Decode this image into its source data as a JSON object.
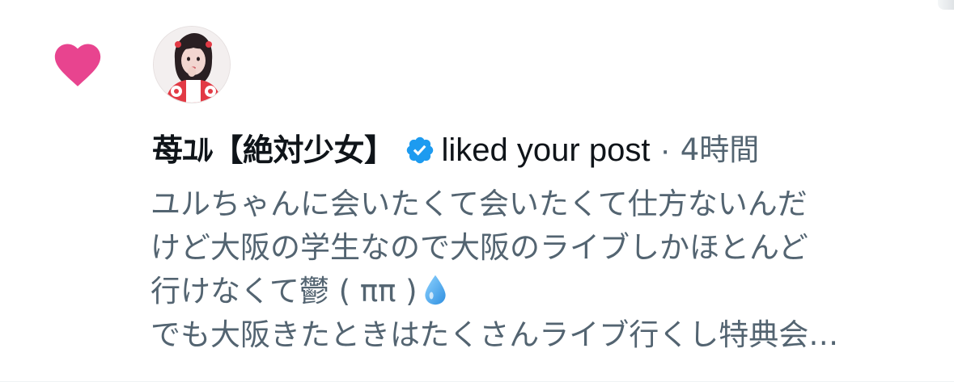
{
  "notification": {
    "type_icon": "heart-icon",
    "user": {
      "display_name": "苺ﾕﾙ【絶対少女】",
      "verified": true,
      "badge_icon": "verified-badge-icon"
    },
    "action": "liked your post",
    "separator": "·",
    "time": "4時間",
    "post_lines": [
      "ユルちゃんに会いたくて会いたくて仕方ないんだ",
      "けど大阪の学生なので大阪のライブしかほとんど",
      "行けなくて鬱 ( ππ )",
      "でも大阪きたときはたくさんライブ行くし特典会…"
    ],
    "post_emoji": "droplet-icon"
  },
  "colors": {
    "heart": "#e8448f",
    "verified": "#1d9bf0",
    "name_text": "#0f1419",
    "secondary_text": "#536471"
  }
}
